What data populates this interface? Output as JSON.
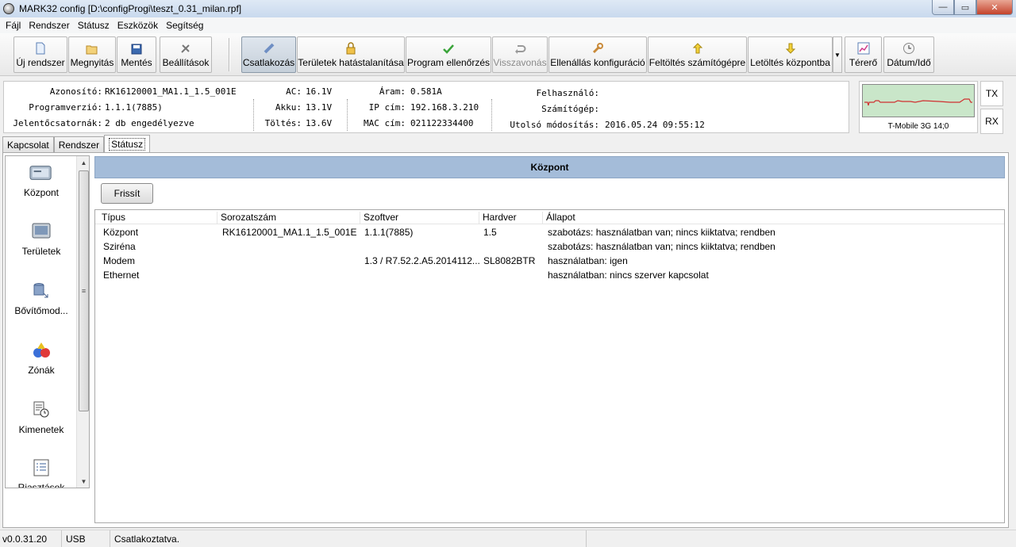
{
  "window": {
    "title": "MARK32 config [D:\\configProgi\\teszt_0.31_milan.rpf]",
    "minimize_glyph": "—",
    "maximize_glyph": "▭",
    "close_glyph": "✕"
  },
  "menu": [
    "Fájl",
    "Rendszer",
    "Státusz",
    "Eszközök",
    "Segítség"
  ],
  "toolbar": {
    "new_system": "Új rendszer",
    "open": "Megnyitás",
    "save": "Mentés",
    "settings": "Beállítások",
    "connect": "Csatlakozás",
    "disable_areas": "Területek hatástalanítása",
    "program_check": "Program ellenőrzés",
    "undo": "Visszavonás",
    "resistance_config": "Ellenállás konfiguráció",
    "upload_pc": "Feltöltés számítógépre",
    "download_central": "Letöltés központba",
    "field_strength": "Térerő",
    "date_time": "Dátum/Idő",
    "dropdown_glyph": "▼"
  },
  "info": {
    "id_label": "Azonosító:",
    "id_value": "RK16120001_MA1.1_1.5_001E",
    "progver_label": "Programverzió:",
    "progver_value": "1.1.1(7885)",
    "channels_label": "Jelentőcsatornák:",
    "channels_value": "2 db engedélyezve",
    "ac_label": "AC:",
    "ac_value": "16.1V",
    "battery_label": "Akku:",
    "battery_value": "13.1V",
    "charge_label": "Töltés:",
    "charge_value": "13.6V",
    "current_label": "Áram:",
    "current_value": "0.581A",
    "ip_label": "IP cím:",
    "ip_value": "192.168.3.210",
    "mac_label": "MAC cím:",
    "mac_value": "021122334400",
    "user_label": "Felhasználó:",
    "user_value": "",
    "computer_label": "Számítógép:",
    "computer_value": "",
    "modified_label": "Utolsó módosítás:",
    "modified_value": "2016.05.24 09:55:12"
  },
  "signal": {
    "operator": "T-Mobile 3G 14;0",
    "tx": "TX",
    "rx": "RX",
    "graph_color": "#c9e6c9",
    "line_color": "#d03030"
  },
  "tabs": [
    "Kapcsolat",
    "Rendszer",
    "Státusz"
  ],
  "nav": {
    "items": [
      "Központ",
      "Területek",
      "Bővítőmod...",
      "Zónák",
      "Kimenetek",
      "Riasztások"
    ],
    "scroll_up": "▲",
    "scroll_down": "▼",
    "scroll_grip": "≡"
  },
  "panel": {
    "header": "Központ",
    "refresh_button": "Frissít",
    "header_color": "#a4bcd9"
  },
  "table": {
    "columns": [
      "Típus",
      "Sorozatszám",
      "Szoftver",
      "Hardver",
      "Állapot"
    ],
    "rows": [
      [
        "Központ",
        "RK16120001_MA1.1_1.5_001E",
        "1.1.1(7885)",
        "1.5",
        "szabotázs: használatban van; nincs kiiktatva; rendben"
      ],
      [
        "Sziréna",
        "",
        "",
        "",
        "szabotázs: használatban van; nincs kiiktatva; rendben"
      ],
      [
        "Modem",
        "",
        "1.3 / R7.52.2.A5.2014112...",
        "SL8082BTR",
        "használatban: igen"
      ],
      [
        "Ethernet",
        "",
        "",
        "",
        "használatban: nincs szerver kapcsolat"
      ]
    ]
  },
  "statusbar": {
    "version": "v0.0.31.20",
    "interface": "USB",
    "status": "Csatlakoztatva."
  }
}
